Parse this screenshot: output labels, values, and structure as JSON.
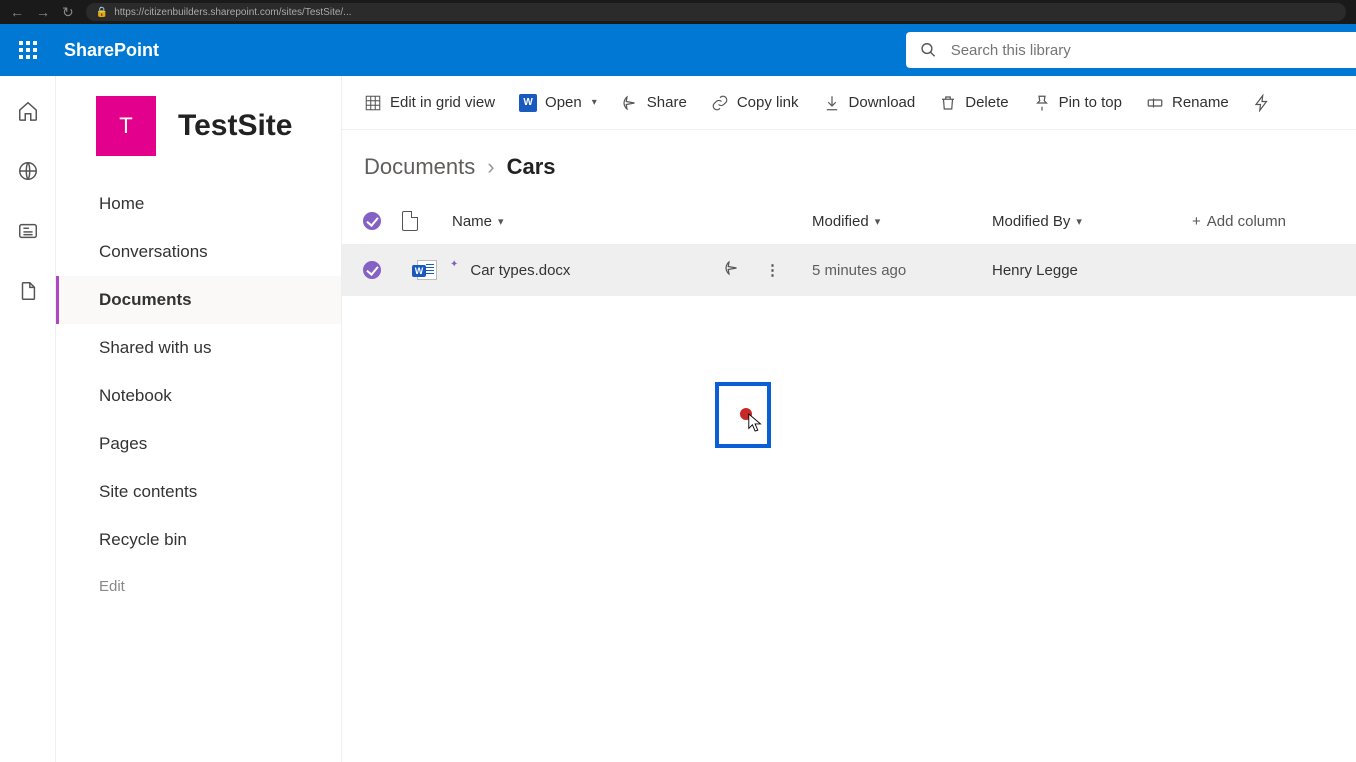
{
  "browser": {
    "url_fragment": "https://citizenbuilders.sharepoint.com/sites/TestSite/..."
  },
  "suite": {
    "brand": "SharePoint",
    "search_placeholder": "Search this library"
  },
  "site": {
    "tile_letter": "T",
    "name": "TestSite"
  },
  "nav": {
    "items": [
      {
        "label": "Home"
      },
      {
        "label": "Conversations"
      },
      {
        "label": "Documents"
      },
      {
        "label": "Shared with us"
      },
      {
        "label": "Notebook"
      },
      {
        "label": "Pages"
      },
      {
        "label": "Site contents"
      },
      {
        "label": "Recycle bin"
      }
    ],
    "edit_label": "Edit",
    "active_index": 2
  },
  "commands": {
    "edit_grid": "Edit in grid view",
    "open": "Open",
    "share": "Share",
    "copy_link": "Copy link",
    "download": "Download",
    "delete": "Delete",
    "pin": "Pin to top",
    "rename": "Rename"
  },
  "breadcrumb": {
    "parent": "Documents",
    "current": "Cars"
  },
  "columns": {
    "name": "Name",
    "modified": "Modified",
    "modified_by": "Modified By",
    "add": "Add column"
  },
  "rows": [
    {
      "name": "Car types.docx",
      "modified": "5 minutes ago",
      "modified_by": "Henry Legge"
    }
  ]
}
